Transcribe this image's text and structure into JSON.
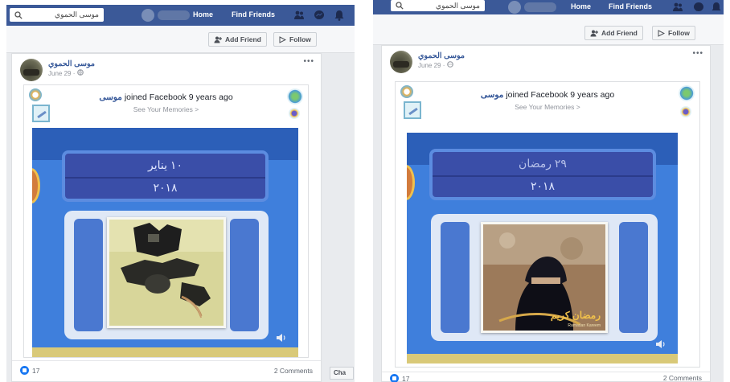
{
  "colors": {
    "brand": "#3b5998",
    "link": "#365899",
    "memory_bg": "#3f7fdc",
    "date_panel": "#3a4ea8"
  },
  "left": {
    "search": {
      "value": "موسى الحموي"
    },
    "nav": {
      "home": "Home",
      "find_friends": "Find Friends"
    },
    "actions": {
      "add_friend": "Add Friend",
      "follow": "Follow"
    },
    "post": {
      "author": "موسى الحموي",
      "date": "June 29 · ",
      "more": "•••",
      "memory": {
        "name": "موسى",
        "joined_text": " joined Facebook 9 years ago",
        "see_memories": "See Your Memories >",
        "date_line1": "١٠ يناير",
        "date_line2": "٢٠١٨"
      },
      "reactions": "17",
      "comments": "2 Comments"
    },
    "chat_label": "Cha"
  },
  "right": {
    "search": {
      "value": "موسى الحموي"
    },
    "nav": {
      "home": "Home",
      "find_friends": "Find Friends"
    },
    "actions": {
      "add_friend": "Add Friend",
      "follow": "Follow"
    },
    "post": {
      "author": "موسى الحموي",
      "date": "June 29 · ",
      "more": "•••",
      "memory": {
        "name": "موسى",
        "joined_text": " joined Facebook 9 years ago",
        "see_memories": "See Your Memories >",
        "date_line1": "٢٩ رمضان",
        "date_line2": "٢٠١٨",
        "photo_caption": "رمضان كريم",
        "photo_caption_en": "Ramadan Kareem"
      },
      "reactions": "17",
      "comments": "2 Comments"
    }
  },
  "icons": [
    "search-icon",
    "friends-icon",
    "messenger-icon",
    "notifications-icon",
    "add-friend-icon",
    "follow-icon",
    "globe-icon",
    "like-icon",
    "sound-icon"
  ]
}
